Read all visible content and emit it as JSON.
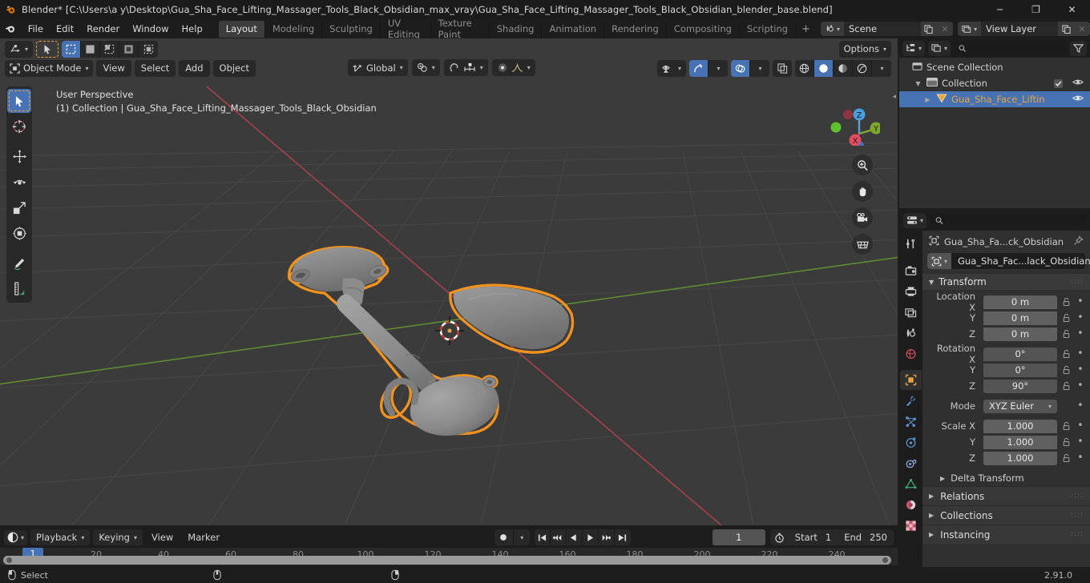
{
  "window": {
    "title": "Blender* [C:\\Users\\a y\\Desktop\\Gua_Sha_Face_Lifting_Massager_Tools_Black_Obsidian_max_vray\\Gua_Sha_Face_Lifting_Massager_Tools_Black_Obsidian_blender_base.blend]",
    "minimize": "─",
    "maximize": "❐",
    "close": "✕"
  },
  "topbar": {
    "menus": [
      "File",
      "Edit",
      "Render",
      "Window",
      "Help"
    ],
    "workspaces": [
      {
        "label": "Layout",
        "active": true
      },
      {
        "label": "Modeling",
        "active": false
      },
      {
        "label": "Sculpting",
        "active": false
      },
      {
        "label": "UV Editing",
        "active": false
      },
      {
        "label": "Texture Paint",
        "active": false
      },
      {
        "label": "Shading",
        "active": false
      },
      {
        "label": "Animation",
        "active": false
      },
      {
        "label": "Rendering",
        "active": false
      },
      {
        "label": "Compositing",
        "active": false
      },
      {
        "label": "Scripting",
        "active": false
      }
    ],
    "add_workspace": "+",
    "scene_name": "Scene",
    "view_layer_name": "View Layer"
  },
  "viewport": {
    "mode": "Object Mode",
    "menus": [
      "View",
      "Select",
      "Add",
      "Object"
    ],
    "transform_orientation": "Global",
    "options_label": "Options",
    "overlay_text_line1": "User Perspective",
    "overlay_text_line2": "(1) Collection | Gua_Sha_Face_Lifting_Massager_Tools_Black_Obsidian",
    "gizmo_axes": [
      "X",
      "Y",
      "Z"
    ],
    "select_modes": [
      "set",
      "extend",
      "subtract",
      "invert",
      "intersect"
    ],
    "tools": [
      "select-box-tool",
      "cursor-tool",
      "move-tool",
      "rotate-tool",
      "scale-tool",
      "transform-tool",
      "annotate-tool",
      "measure-tool"
    ],
    "nav_buttons": [
      "zoom-icon",
      "pan-hand-icon",
      "camera-icon",
      "ortho-grid-icon"
    ],
    "shading_modes": [
      "wireframe",
      "solid",
      "material-preview",
      "rendered"
    ],
    "active_shading": "solid"
  },
  "outliner": {
    "search_placeholder": "",
    "display_mode": "view-layer",
    "rows": [
      {
        "label": "Scene Collection",
        "indent": 0,
        "icon": "collection-icon",
        "selected": false,
        "has_disclosure": false,
        "has_checkbox": false,
        "has_eye": false
      },
      {
        "label": "Collection",
        "indent": 1,
        "icon": "collection-icon",
        "selected": false,
        "has_disclosure": true,
        "has_checkbox": true,
        "has_eye": true
      },
      {
        "label": "Gua_Sha_Face_Liftin",
        "indent": 2,
        "icon": "mesh-object-icon",
        "selected": true,
        "has_disclosure": true,
        "has_checkbox": false,
        "has_eye": true
      }
    ]
  },
  "properties": {
    "search_placeholder": "",
    "breadcrumb_object": "Gua_Sha_Fa...ck_Obsidian",
    "id_name": "Gua_Sha_Fac...lack_Obsidian",
    "tabs": [
      "tool-icon",
      "render-icon",
      "output-icon",
      "view-layer-icon",
      "scene-icon",
      "world-icon",
      "object-icon",
      "modifiers-icon",
      "particles-icon",
      "physics-icon",
      "constraints-icon",
      "data-icon",
      "material-icon",
      "texture-icon"
    ],
    "active_tab": "object-icon",
    "transform": {
      "title": "Transform",
      "location": {
        "label": "Location X",
        "sub": [
          "Y",
          "Z"
        ],
        "values": [
          "0 m",
          "0 m",
          "0 m"
        ]
      },
      "rotation": {
        "label": "Rotation X",
        "sub": [
          "Y",
          "Z"
        ],
        "values": [
          "0°",
          "0°",
          "90°"
        ]
      },
      "mode": {
        "label": "Mode",
        "value": "XYZ Euler"
      },
      "scale": {
        "label": "Scale X",
        "sub": [
          "Y",
          "Z"
        ],
        "values": [
          "1.000",
          "1.000",
          "1.000"
        ]
      },
      "delta": "Delta Transform"
    },
    "closed_panels": [
      "Relations",
      "Collections",
      "Instancing"
    ]
  },
  "timeline": {
    "editor_type": "timeline-icon",
    "menus": [
      "Playback",
      "Keying",
      "View",
      "Marker"
    ],
    "auto_key": "record-icon",
    "playback_buttons": [
      "jump-start",
      "prev-keyframe",
      "play-reverse",
      "play",
      "next-keyframe",
      "jump-end"
    ],
    "current_frame": "1",
    "start_label": "Start",
    "start_value": "1",
    "end_label": "End",
    "end_value": "250",
    "ticks": [
      {
        "label": "20",
        "frame": 20
      },
      {
        "label": "40",
        "frame": 40
      },
      {
        "label": "60",
        "frame": 60
      },
      {
        "label": "80",
        "frame": 80
      },
      {
        "label": "100",
        "frame": 100
      },
      {
        "label": "120",
        "frame": 120
      },
      {
        "label": "140",
        "frame": 140
      },
      {
        "label": "160",
        "frame": 160
      },
      {
        "label": "180",
        "frame": 180
      },
      {
        "label": "200",
        "frame": 200
      },
      {
        "label": "220",
        "frame": 220
      },
      {
        "label": "240",
        "frame": 240
      }
    ],
    "playhead_label": "1"
  },
  "statusbar": {
    "mouse_hint_label": "Select",
    "version": "2.91.0"
  },
  "colors": {
    "accent_blue": "#4772b3",
    "selected_orange": "#e8a33d",
    "viewport_bg": "#3b3b3b",
    "panel_bg": "#303030",
    "header_bg": "#1d1d1d",
    "axis_x_red": "#a8414c",
    "axis_y_green": "#5d8c32"
  }
}
